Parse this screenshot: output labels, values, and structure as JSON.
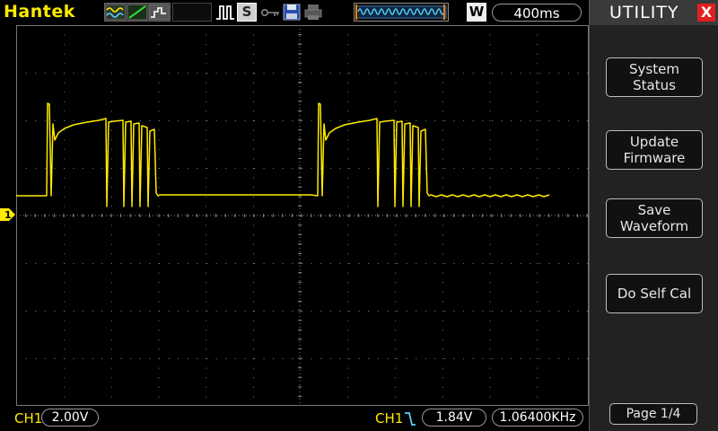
{
  "brand": "Hantek",
  "toolbar": {
    "icons": [
      "waveform-mode-icon",
      "ramp-icon",
      "persist-icon",
      "pulse-trigger-icon",
      "single-shot-icon",
      "key-lock-icon",
      "save-icon",
      "print-icon",
      "trigger-position-icon",
      "window-icon"
    ],
    "s_label": "S",
    "w_label": "W",
    "timebase": "400ms"
  },
  "menu": {
    "title": "UTILITY",
    "close": "X",
    "buttons": {
      "system_status": "System\nStatus",
      "update_firmware": "Update\nFirmware",
      "save_waveform": "Save\nWaveform",
      "self_cal": "Do Self Cal",
      "page": "Page 1/4"
    }
  },
  "status": {
    "ch1_label": "CH1",
    "ch1_scale": "2.00V",
    "trigger_source": "CH1",
    "trigger_level": "1.84V",
    "frequency": "1.06400KHz"
  },
  "markers": {
    "ch1": "1"
  },
  "colors": {
    "trace": "#ffea00",
    "grid": "#808080",
    "panel": "#222222",
    "close": "#e02020"
  }
}
